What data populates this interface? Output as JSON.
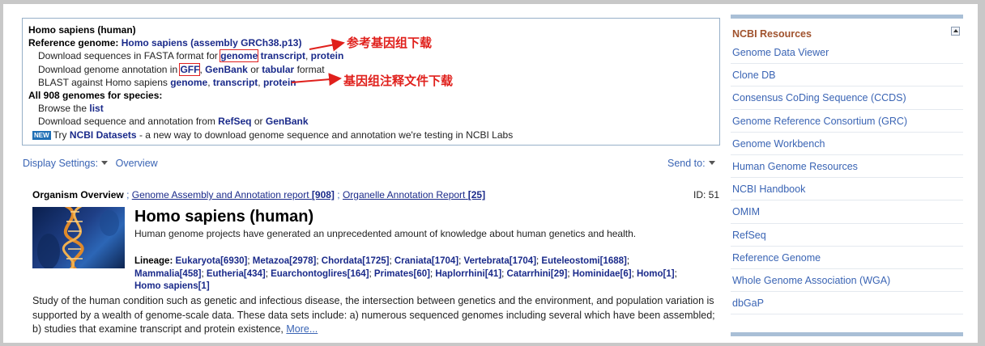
{
  "summary": {
    "organism": "Homo sapiens (human)",
    "ref_label": "Reference genome:",
    "ref_link": "Homo sapiens (assembly GRCh38.p13)",
    "fasta_prefix": "Download sequences in FASTA format for",
    "fasta_genome": "genome",
    "fasta_transcript": "transcript",
    "fasta_protein": "protein",
    "annot_prefix": "Download genome annotation in",
    "annot_gff": "GFF",
    "annot_genbank": "GenBank",
    "annot_or": "or",
    "annot_tabular": "tabular",
    "annot_suffix": "format",
    "blast_prefix": "BLAST against Homo sapiens",
    "blast_genome": "genome",
    "blast_transcript": "transcript",
    "blast_protein": "protein",
    "all_genomes": "All 908 genomes for species:",
    "browse_prefix": "Browse the",
    "browse_list": "list",
    "dl_prefix": "Download sequence and annotation from",
    "dl_refseq": "RefSeq",
    "dl_or": "or",
    "dl_genbank": "GenBank",
    "new_badge": "NEW",
    "try_prefix": "Try",
    "try_link": "NCBI Datasets",
    "try_suffix": "- a new way to download genome sequence and annotation we're testing in NCBI Labs"
  },
  "annotations": {
    "ref_genome_download": "参考基因组下载",
    "annotation_download": "基因组注释文件下载",
    "color": "#e0201c"
  },
  "toolbar": {
    "display_settings": "Display Settings:",
    "overview": "Overview",
    "send_to": "Send to:"
  },
  "overview": {
    "heading": "Organism Overview",
    "sep": ";",
    "assembly_report": "Genome Assembly and Annotation report",
    "assembly_count": "[908]",
    "organelle_report": "Organelle Annotation Report",
    "organelle_count": "[25]",
    "id_label": "ID: 51",
    "title": "Homo sapiens (human)",
    "description": "Human genome projects have generated an unprecedented amount of knowledge about human genetics and health.",
    "lineage_label": "Lineage:",
    "lineage": [
      "Eukaryota[6930]",
      "Metazoa[2978]",
      "Chordata[1725]",
      "Craniata[1704]",
      "Vertebrata[1704]",
      "Euteleostomi[1688]",
      "Mammalia[458]",
      "Eutheria[434]",
      "Euarchontoglires[164]",
      "Primates[60]",
      "Haplorrhini[41]",
      "Catarrhini[29]",
      "Hominidae[6]",
      "Homo[1]",
      "Homo sapiens[1]"
    ],
    "study_text": "Study of the human condition such as genetic and infectious disease, the intersection between genetics and the environment, and population variation is supported by a wealth of genome-scale data. These data sets include: a) numerous sequenced genomes including several which have been assembled; b) studies that examine transcript and protein existence,",
    "more": "More..."
  },
  "sidebar": {
    "title": "NCBI Resources",
    "items": [
      "Genome Data Viewer",
      "Clone DB",
      "Consensus CoDing Sequence (CCDS)",
      "Genome Reference Consortium (GRC)",
      "Genome Workbench",
      "Human Genome Resources",
      "NCBI Handbook",
      "OMIM",
      "RefSeq",
      "Reference Genome",
      "Whole Genome Association (WGA)",
      "dbGaP"
    ]
  },
  "colors": {
    "link": "#1a2a8a",
    "light_link": "#3a64b4",
    "sidebar_title": "#a0522d",
    "highlight_box": "#e02020"
  }
}
